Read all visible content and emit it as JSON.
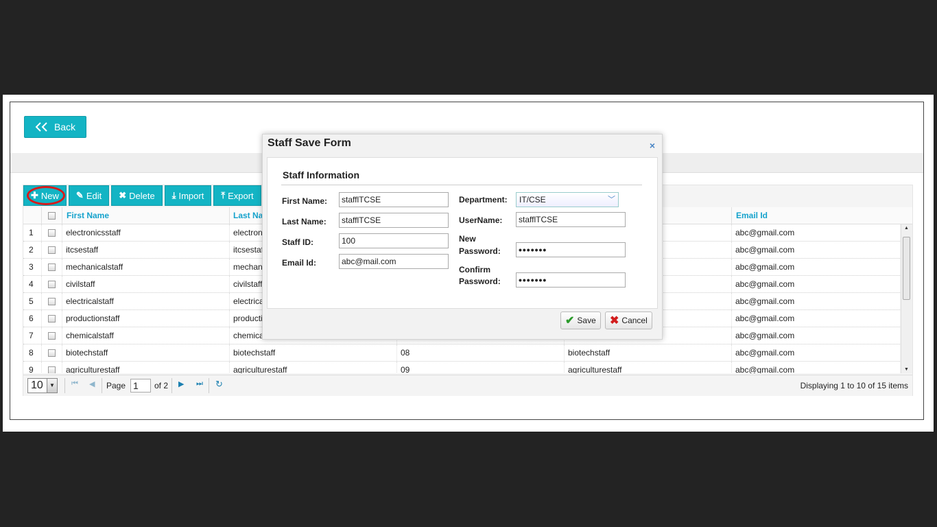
{
  "back_button": {
    "label": "Back"
  },
  "toolbar": {
    "new_label": "New",
    "edit_label": "Edit",
    "delete_label": "Delete",
    "import_label": "Import",
    "export_label": "Export"
  },
  "grid": {
    "columns": {
      "first_name": "First Name",
      "last_name": "Last Na",
      "email_id": "Email Id"
    },
    "rows": [
      {
        "num": "1",
        "first": "electronicsstaff",
        "last": "electronic",
        "id": "",
        "dept": "",
        "email": "abc@gmail.com"
      },
      {
        "num": "2",
        "first": "itcsestaff",
        "last": "itcsestaff",
        "id": "",
        "dept": "",
        "email": "abc@gmail.com"
      },
      {
        "num": "3",
        "first": "mechanicalstaff",
        "last": "mechani",
        "id": "",
        "dept": "",
        "email": "abc@gmail.com"
      },
      {
        "num": "4",
        "first": "civilstaff",
        "last": "civilstaff",
        "id": "",
        "dept": "",
        "email": "abc@gmail.com"
      },
      {
        "num": "5",
        "first": "electricalstaff",
        "last": "electrical",
        "id": "",
        "dept": "",
        "email": "abc@gmail.com"
      },
      {
        "num": "6",
        "first": "productionstaff",
        "last": "productic",
        "id": "",
        "dept": "",
        "email": "abc@gmail.com"
      },
      {
        "num": "7",
        "first": "chemicalstaff",
        "last": "chemical",
        "id": "",
        "dept": "",
        "email": "abc@gmail.com"
      },
      {
        "num": "8",
        "first": "biotechstaff",
        "last": "biotechstaff",
        "id": "08",
        "dept": "biotechstaff",
        "email": "abc@gmail.com"
      },
      {
        "num": "9",
        "first": "agriculturestaff",
        "last": "agriculturestaff",
        "id": "09",
        "dept": "agriculturestaff",
        "email": "abc@gmail.com"
      }
    ]
  },
  "pager": {
    "page_size": "10",
    "page_label": "Page",
    "page_value": "1",
    "of_label": "of 2",
    "status": "Displaying 1 to 10 of 15 items"
  },
  "dialog": {
    "title": "Staff Save Form",
    "close": "×",
    "section": "Staff Information",
    "first_name_label": "First Name:",
    "first_name_value": "stafflTCSE",
    "last_name_label": "Last Name:",
    "last_name_value": "stafflTCSE",
    "staff_id_label": "Staff ID:",
    "staff_id_value": "100",
    "email_label": "Email Id:",
    "email_value": "abc@mail.com",
    "department_label": "Department:",
    "department_value": "IT/CSE",
    "username_label": "UserName:",
    "username_value": "stafflTCSE",
    "new_password_label_1": "New",
    "new_password_label_2": "Password:",
    "new_password_value": "•••••••",
    "confirm_password_label_1": "Confirm",
    "confirm_password_label_2": "Password:",
    "confirm_password_value": "•••••••",
    "save_label": "Save",
    "cancel_label": "Cancel"
  },
  "colors": {
    "accent": "#13b4c4",
    "header_text": "#14a2cc",
    "highlight_ring": "#d81a1a"
  }
}
